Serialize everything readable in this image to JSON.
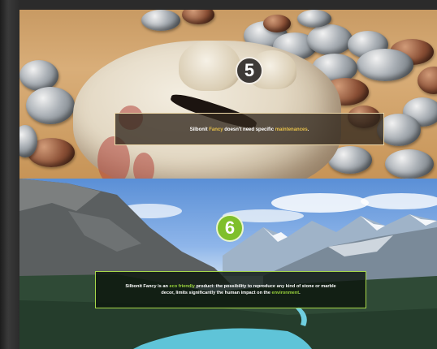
{
  "slides": [
    {
      "number": "5",
      "caption": {
        "brand": "Silbonit",
        "highlight_1": "Fancy",
        "mid": "doesn't need specific",
        "highlight_2": "maintenances",
        "end": "."
      },
      "colors": {
        "highlight": "#e6c04a",
        "border": "#efd9a8",
        "badge_bg": "#3e3a37"
      },
      "image": "piggy-bank-coins"
    },
    {
      "number": "6",
      "caption": {
        "line1_a": "Silbonit Fancy is an",
        "line1_hl": "eco friendly",
        "line1_b": "product: the possibility to reproduce any kind of stone or marble",
        "line2_a": "decor, limits significantly the human impact on the",
        "line2_hl": "environment",
        "line2_b": "."
      },
      "colors": {
        "highlight": "#9cd63d",
        "border": "#a7d84a",
        "badge_bg": "#7fbf2b"
      },
      "image": "mountain-lake-landscape"
    }
  ]
}
